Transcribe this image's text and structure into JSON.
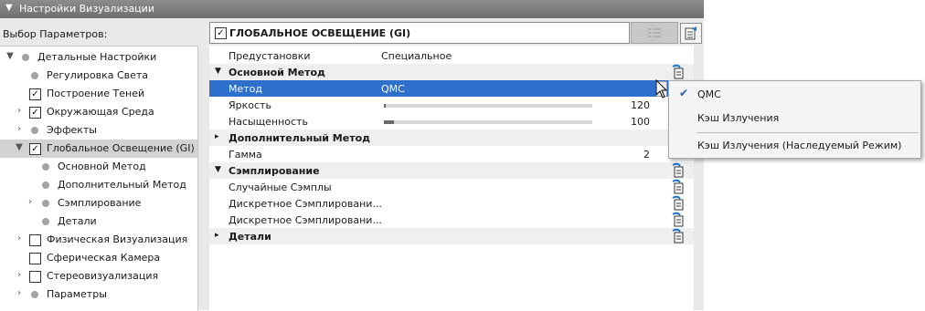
{
  "window": {
    "title": "Настройки Визуализации"
  },
  "selector": {
    "label": "Выбор Параметров:"
  },
  "tree": [
    {
      "label": "Детальные Настройки",
      "kind": "dot",
      "expander": "down"
    },
    {
      "label": "Регулировка Света",
      "kind": "dot",
      "expander": ""
    },
    {
      "label": "Построение Теней",
      "kind": "check",
      "checked": true,
      "expander": ""
    },
    {
      "label": "Окружающая Среда",
      "kind": "check",
      "checked": true,
      "expander": "right"
    },
    {
      "label": "Эффекты",
      "kind": "dot",
      "expander": "right"
    },
    {
      "label": "Глобальное Освещение (GI)",
      "kind": "check",
      "checked": true,
      "expander": "down",
      "selected": true
    },
    {
      "label": "Основной Метод",
      "kind": "dot",
      "expander": ""
    },
    {
      "label": "Дополнительный Метод",
      "kind": "dot",
      "expander": ""
    },
    {
      "label": "Сэмплирование",
      "kind": "dot",
      "expander": "right"
    },
    {
      "label": "Детали",
      "kind": "dot",
      "expander": ""
    },
    {
      "label": "Физическая Визуализация",
      "kind": "check",
      "checked": false,
      "expander": "right"
    },
    {
      "label": "Сферическая Камера",
      "kind": "check",
      "checked": false,
      "expander": ""
    },
    {
      "label": "Стереовизуализация",
      "kind": "check",
      "checked": false,
      "expander": "right"
    },
    {
      "label": "Параметры",
      "kind": "dot",
      "expander": "right"
    }
  ],
  "header": {
    "title": "ГЛОБАЛЬНОЕ ОСВЕЩЕНИЕ (GI)",
    "checked": true,
    "check_glyph": "✓"
  },
  "grid": {
    "presets": {
      "label": "Предустановки",
      "value": "Специальное"
    },
    "sections": [
      {
        "title": "Основной Метод",
        "expanded": true,
        "rows": [
          {
            "label": "Метод",
            "value": "QMC",
            "type": "dropdown",
            "active": true
          },
          {
            "label": "Яркость",
            "type": "slider",
            "value": "120",
            "fill": 0.01
          },
          {
            "label": "Насыщенность",
            "type": "slider",
            "value": "100",
            "fill": 0.05
          }
        ]
      },
      {
        "title": "Дополнительный Метод",
        "expanded": false,
        "rows": [
          {
            "label": "Гамма",
            "type": "number",
            "value": "2"
          }
        ]
      },
      {
        "title": "Сэмплирование",
        "expanded": true,
        "rows": [
          {
            "label": "Случайные Сэмплы",
            "type": "text"
          },
          {
            "label": "Дискретное Сэмплировани...",
            "type": "text"
          },
          {
            "label": "Дискретное Сэмплировани...",
            "type": "text"
          }
        ]
      },
      {
        "title": "Детали",
        "expanded": false,
        "rows": []
      }
    ]
  },
  "menu": {
    "items": [
      {
        "label": "QMC",
        "checked": true
      },
      {
        "label": "Кэш Излучения",
        "checked": false
      },
      {
        "label": "Кэш Излучения (Наследуемый Режим)",
        "checked": false
      }
    ],
    "check_glyph": "✔"
  },
  "glyphs": {
    "check": "✓",
    "down": "▼",
    "right": "›",
    "dd": "▸",
    "title_arrow": "▼"
  },
  "colors": {
    "selection": "#2f6fcc",
    "accent_icon": "#1b78d0"
  }
}
